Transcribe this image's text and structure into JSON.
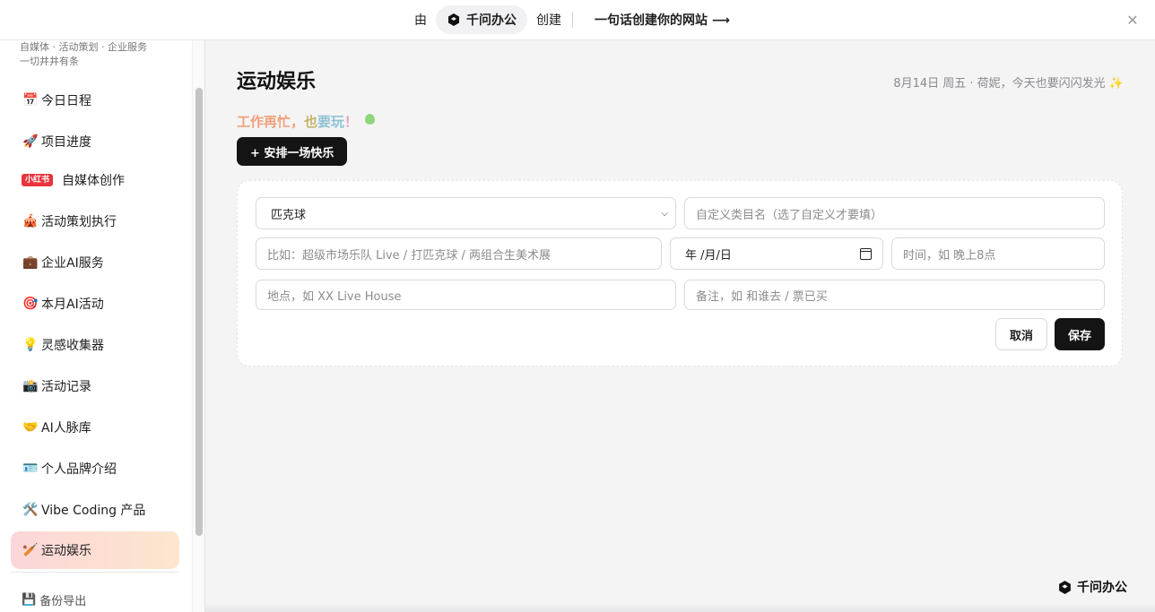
{
  "banner": {
    "by": "由",
    "brand": "千问办公",
    "create": "创建",
    "cta": "一句话创建你的网站 ⟶",
    "close_icon": "close-icon"
  },
  "sidebar": {
    "tagline_line1": "自媒体 · 活动策划 · 企业服务",
    "tagline_line2": "一切井井有条",
    "items": [
      {
        "emoji": "📅",
        "label": "今日日程"
      },
      {
        "emoji": "🚀",
        "label": "项目进度"
      },
      {
        "badge": "小红书",
        "label": "自媒体创作"
      },
      {
        "emoji": "🎪",
        "label": "活动策划执行"
      },
      {
        "emoji": "💼",
        "label": "企业AI服务"
      },
      {
        "emoji": "🎯",
        "label": "本月AI活动"
      },
      {
        "emoji": "💡",
        "label": "灵感收集器"
      },
      {
        "emoji": "📸",
        "label": "活动记录"
      },
      {
        "emoji": "🤝",
        "label": "AI人脉库"
      },
      {
        "emoji": "🪪",
        "label": "个人品牌介绍"
      },
      {
        "emoji": "🛠️",
        "label": "Vibe Coding 产品"
      },
      {
        "emoji": "🏏",
        "label": "运动娱乐",
        "active": true
      }
    ],
    "backup": {
      "emoji": "💾",
      "label": "备份导出"
    }
  },
  "main": {
    "title": "运动娱乐",
    "greeting": "8月14日 周五 · 荷妮，今天也要闪闪发光 ✨",
    "slogan": {
      "part1": "工作再忙，",
      "part2": "也",
      "part3": "要玩",
      "part4": "！"
    },
    "add_button": "+ 安排一场快乐",
    "form": {
      "category_value": "匹克球",
      "custom_category_placeholder": "自定义类目名（选了自定义才要填）",
      "name_placeholder": "比如：超级市场乐队 Live / 打匹克球 / 两组合生美术展",
      "date_value": "年 /月/日",
      "time_placeholder": "时间，如 晚上8点",
      "location_placeholder": "地点，如 XX Live House",
      "note_placeholder": "备注，如 和谁去 / 票已买",
      "cancel": "取消",
      "save": "保存"
    }
  },
  "footer": {
    "brand": "千问办公"
  }
}
